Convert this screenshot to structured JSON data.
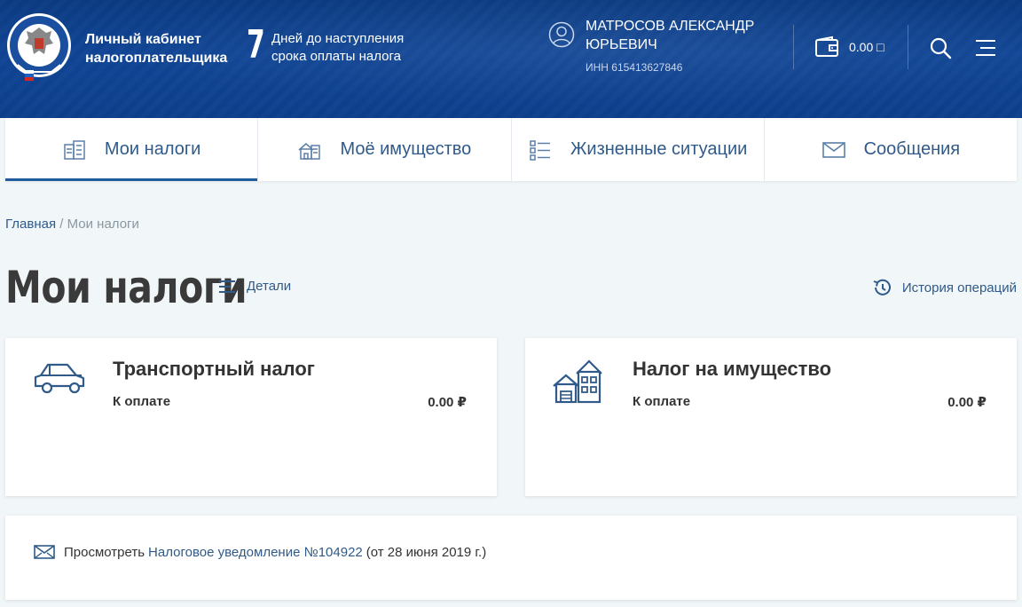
{
  "header": {
    "cabinet_title_line1": "Личный кабинет",
    "cabinet_title_line2": "налогоплательщика",
    "days_count": "7",
    "days_text_line1": "Дней до наступления",
    "days_text_line2": "срока оплаты налога",
    "user_name": "МАТРОСОВ АЛЕКСАНДР ЮРЬЕВИЧ",
    "user_inn": "ИНН 615413627846",
    "wallet_amount": "0.00 □",
    "logo_text": "ФЕДЕРАЛЬНАЯ НАЛОГОВАЯ СЛУЖБА"
  },
  "tabs": [
    {
      "label": "Мои налоги",
      "icon": "tax-document-icon",
      "active": true
    },
    {
      "label": "Моё имущество",
      "icon": "property-icon",
      "active": false
    },
    {
      "label": "Жизненные ситуации",
      "icon": "checklist-icon",
      "active": false
    },
    {
      "label": "Сообщения",
      "icon": "envelope-icon",
      "active": false
    }
  ],
  "breadcrumb": {
    "home": "Главная",
    "separator": "/",
    "current": "Мои налоги"
  },
  "page": {
    "title": "Мои налоги",
    "details_label": "Детали",
    "history_label": "История операций"
  },
  "tax_cards": [
    {
      "title": "Транспортный налог",
      "pay_label": "К оплате",
      "amount": "0.00 ₽",
      "icon": "car-icon"
    },
    {
      "title": "Налог на имущество",
      "pay_label": "К оплате",
      "amount": "0.00 ₽",
      "icon": "house-icon"
    }
  ],
  "notice": {
    "prefix": "Просмотреть",
    "link_text": "Налоговое уведомление №104922",
    "suffix": "(от 28 июня 2019 г.)"
  },
  "colors": {
    "header_bg": "#0d3f8c",
    "accent": "#2f5a8a",
    "page_bg": "#f1f6f8"
  }
}
